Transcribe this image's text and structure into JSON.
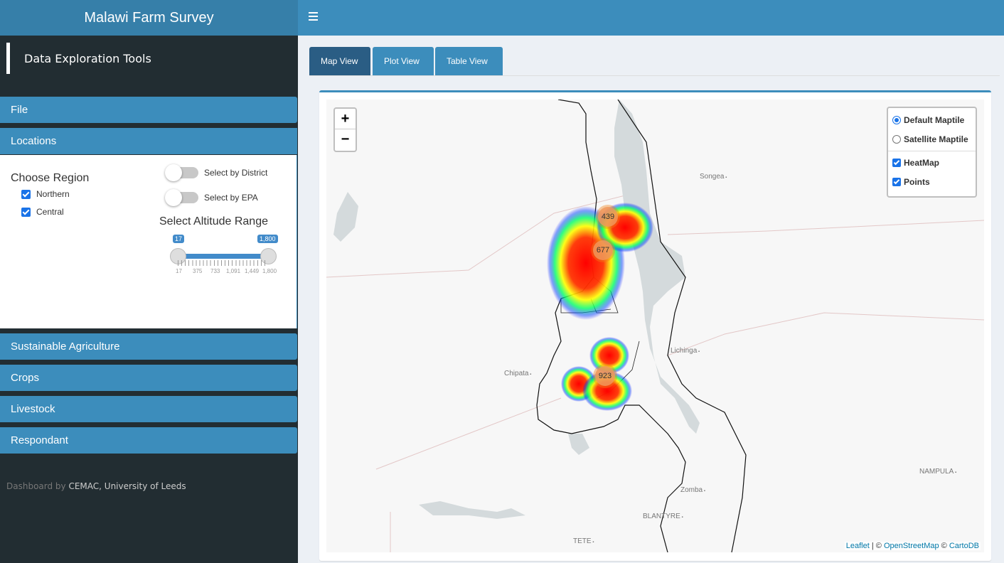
{
  "app": {
    "title": "Malawi Farm Survey"
  },
  "sidebar": {
    "title": "Data Exploration Tools",
    "sections": {
      "file": "File",
      "locations": "Locations",
      "sustainable": "Sustainable Agriculture",
      "crops": "Crops",
      "livestock": "Livestock",
      "respondant": "Respondant"
    },
    "locations": {
      "choose_region": "Choose Region",
      "regions": [
        {
          "label": "Northern",
          "checked": true
        },
        {
          "label": "Central",
          "checked": true
        }
      ],
      "toggle_district": "Select by District",
      "toggle_epa": "Select by EPA",
      "altitude_title": "Select Altitude Range",
      "altitude_min": "17",
      "altitude_max": "1,800",
      "tick_labels": [
        "17",
        "375",
        "733",
        "1,091",
        "1,449",
        "1,800"
      ]
    },
    "footer_prefix": "Dashboard by",
    "footer_credit": "CEMAC, University of Leeds"
  },
  "tabs": [
    "Map View",
    "Plot View",
    "Table View"
  ],
  "active_tab": "Map View",
  "map": {
    "zoom_in": "+",
    "zoom_out": "−",
    "layers": {
      "default": "Default Maptile",
      "satellite": "Satellite Maptile",
      "heatmap": "HeatMap",
      "points": "Points"
    },
    "places": {
      "songea": "Songea",
      "lichinga": "Lichinga",
      "chipata": "Chipata",
      "nampula": "NAMPULA",
      "zomba": "Zomba",
      "blantyre": "BLANTYRE",
      "tete": "TETE"
    },
    "clusters": [
      "439",
      "677",
      "923"
    ],
    "attribution": {
      "leaflet": "Leaflet",
      "sep1": " | © ",
      "osm": "OpenStreetMap",
      "sep2": " © ",
      "cartodb": "CartoDB"
    }
  }
}
